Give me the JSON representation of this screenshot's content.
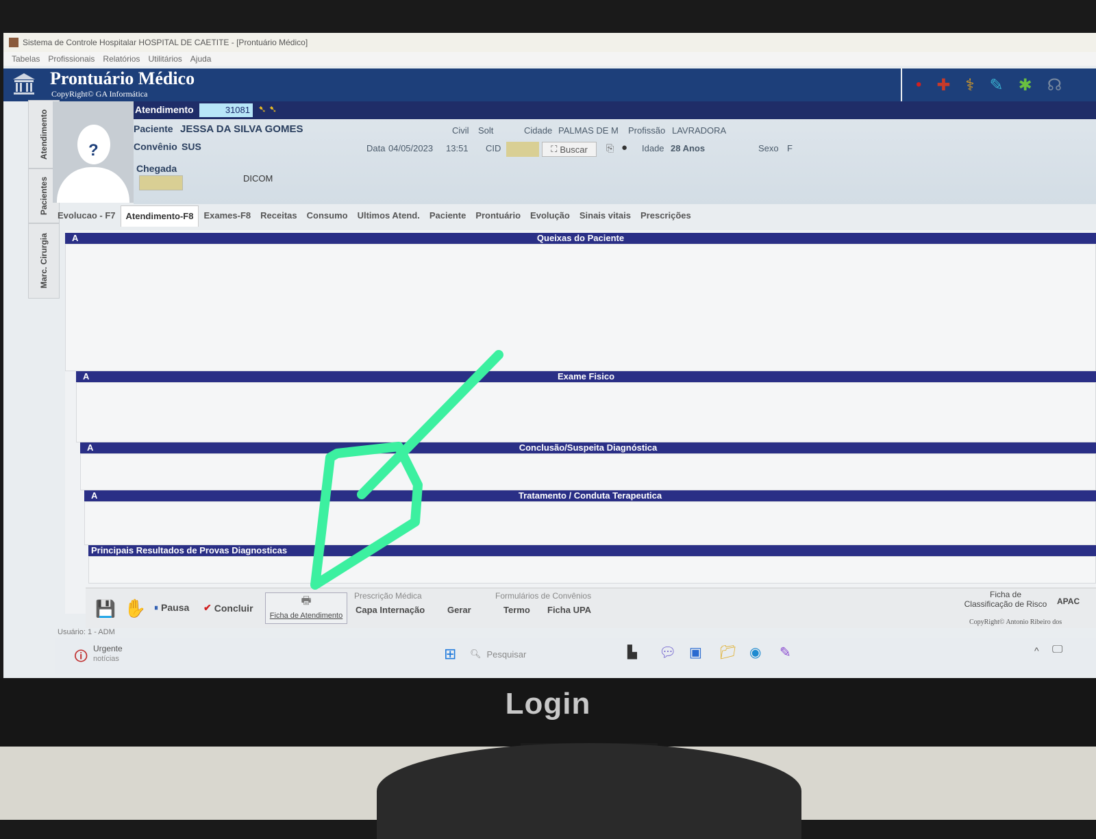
{
  "window": {
    "title": "Sistema de Controle Hospitalar HOSPITAL DE CAETITE - [Prontuário Médico]"
  },
  "menu": {
    "items": [
      "Tabelas",
      "Profissionais",
      "Relatórios",
      "Utilitários",
      "Ajuda"
    ]
  },
  "header": {
    "title": "Prontuário Médico",
    "copyright": "CopyRight© GA Informática"
  },
  "side_tabs": [
    "Atendimento",
    "Pacientes",
    "Marc. Cirurgia"
  ],
  "atendimento": {
    "label": "Atendimento",
    "number": "31081"
  },
  "patient": {
    "paciente_label": "Paciente",
    "name": "JESSA DA SILVA GOMES",
    "civil_label": "Civil",
    "civil_value": "Solt",
    "cidade_label": "Cidade",
    "cidade_value": "PALMAS DE M",
    "profissao_label": "Profissão",
    "profissao_value": "LAVRADORA",
    "convenio_label": "Convênio",
    "convenio_value": "SUS",
    "data_label": "Data",
    "data_value": "04/05/2023",
    "hora_value": "13:51",
    "cid_label": "CID",
    "buscar_label": "Buscar",
    "idade_label": "Idade",
    "idade_value": "28 Anos",
    "sexo_label": "Sexo",
    "sexo_value": "F",
    "chegada_label": "Chegada",
    "dicom_label": "DICOM"
  },
  "tabs": [
    "Evolucao - F7",
    "Atendimento-F8",
    "Exames-F8",
    "Receitas",
    "Consumo",
    "Ultimos Atend.",
    "Paciente",
    "Prontuário",
    "Evolução",
    "Sinais vitais",
    "Prescrições"
  ],
  "sections": {
    "marker": "A",
    "queixas": "Queixas do Paciente",
    "exame": "Exame Fisico",
    "conclusao": "Conclusão/Suspeita Diagnóstica",
    "tratamento": "Tratamento / Conduta Terapeutica",
    "resultados": "Principais Resultados de Provas Diagnosticas"
  },
  "toolbar": {
    "pausa": "Pausa",
    "concluir": "Concluir",
    "ficha_atendimento": "Ficha de Atendimento",
    "prescricao_label": "Prescrição Médica",
    "capa_internacao": "Capa Internação",
    "gerar": "Gerar",
    "formularios_label": "Formulários de Convênios",
    "termo": "Termo",
    "ficha_upa": "Ficha UPA",
    "classificacao_line1": "Ficha de",
    "classificacao_line2": "Classificação de Risco",
    "apac": "APAC",
    "copyright": "CopyRight© Antonio Ribeiro dos"
  },
  "status": {
    "usuario": "Usuário: 1 - ADM"
  },
  "taskbar": {
    "notif_line1": "Urgente",
    "notif_line2": "notícias",
    "search_placeholder": "Pesquisar"
  },
  "monitor": {
    "brand": "Login"
  }
}
